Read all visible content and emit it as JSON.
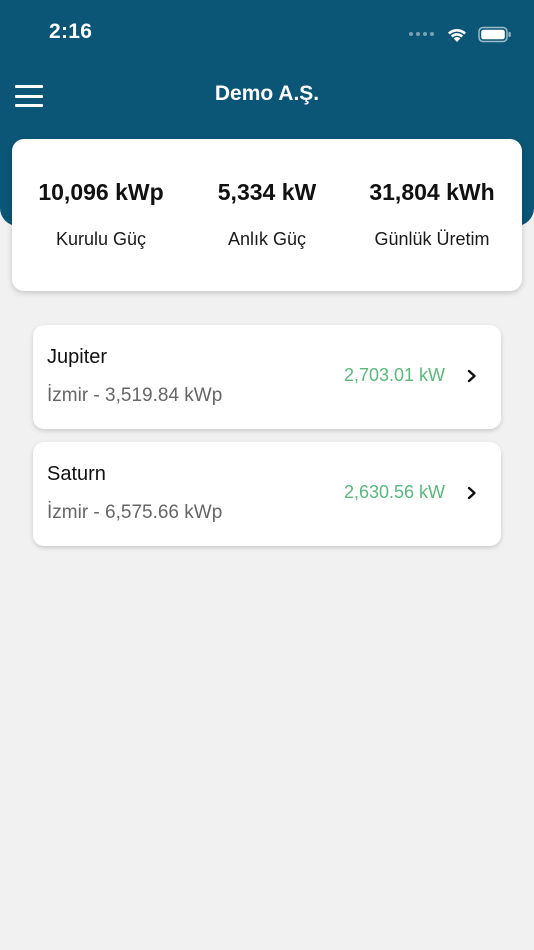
{
  "status_bar": {
    "time": "2:16"
  },
  "header": {
    "title": "Demo A.Ş."
  },
  "summary": {
    "installed_value": "10,096 kWp",
    "installed_label": "Kurulu Güç",
    "instant_value": "5,334 kW",
    "instant_label": "Anlık Güç",
    "daily_value": "31,804 kWh",
    "daily_label": "Günlük Üretim"
  },
  "plants": [
    {
      "name": "Jupiter",
      "subtitle": "İzmir - 3,519.84 kWp",
      "power": "2,703.01 kW"
    },
    {
      "name": "Saturn",
      "subtitle": "İzmir - 6,575.66 kWp",
      "power": "2,630.56 kW"
    }
  ],
  "colors": {
    "header": "#0b5577",
    "background": "#f1f1f1",
    "power_green": "#58b97b"
  }
}
